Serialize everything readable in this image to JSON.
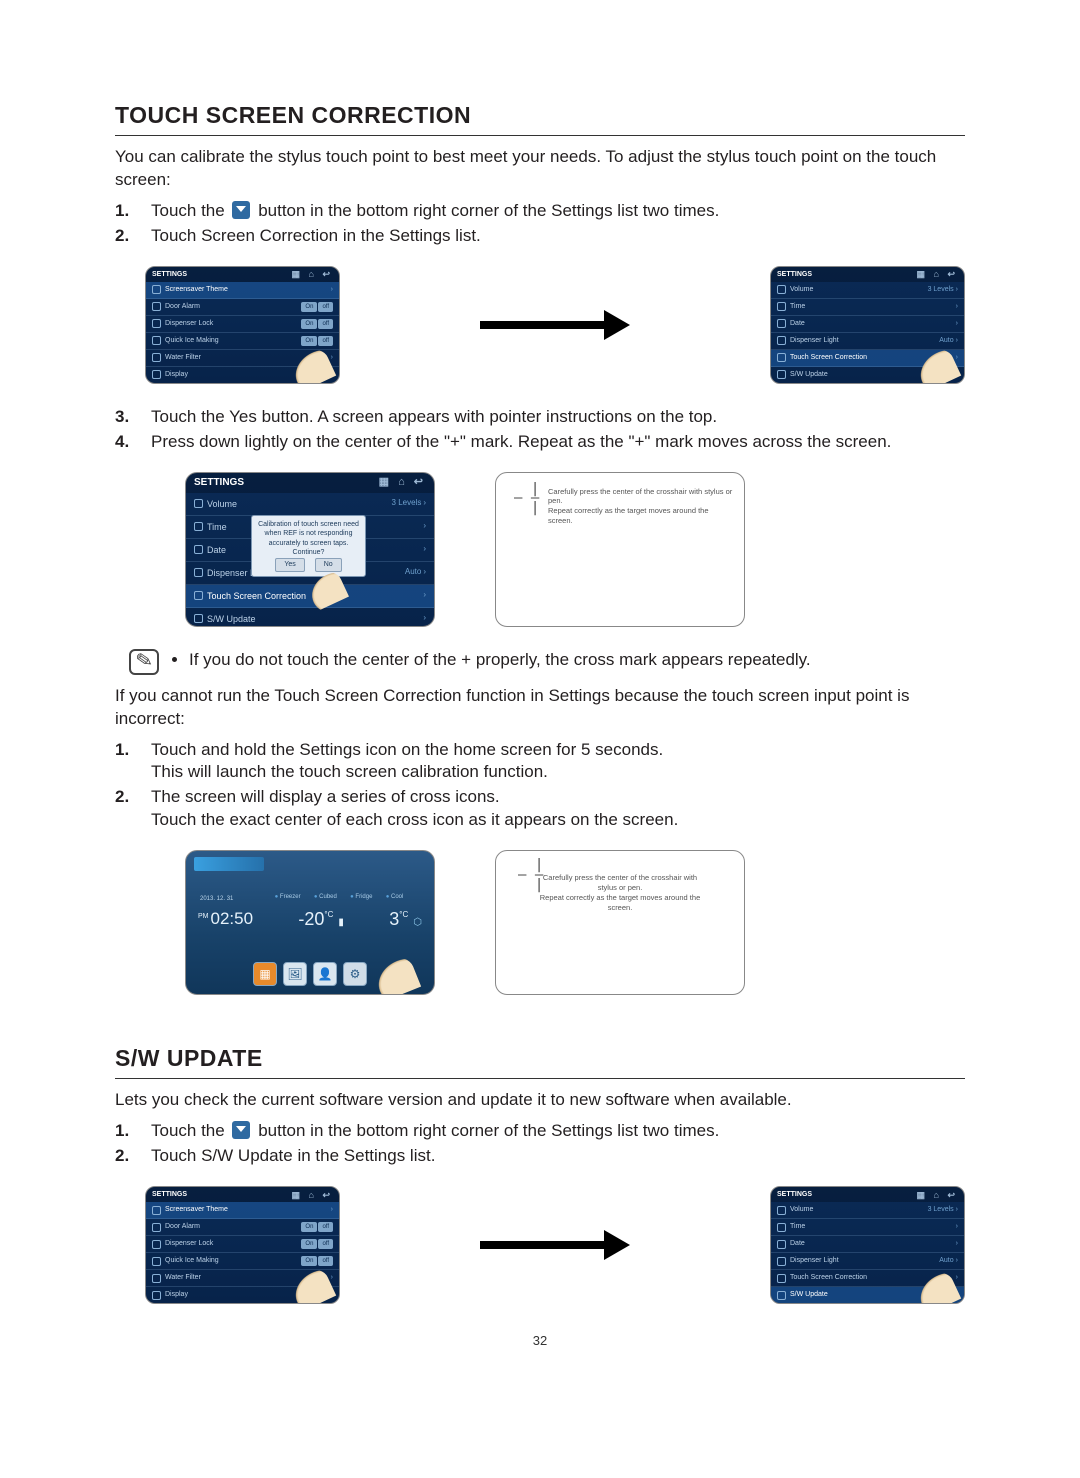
{
  "page_number": "32",
  "touch_correction": {
    "heading": "TOUCH SCREEN CORRECTION",
    "intro": "You can calibrate the stylus touch point to best meet your needs. To adjust the stylus touch point on the touch screen:",
    "steps_a": [
      {
        "n": "1.",
        "before": "Touch the ",
        "after": " button in the bottom right corner of the Settings list two times."
      },
      {
        "n": "2.",
        "text": "Touch Screen Correction in the Settings list."
      }
    ],
    "steps_b": [
      {
        "n": "3.",
        "text": "Touch the Yes button. A screen appears with pointer instructions on the top."
      },
      {
        "n": "4.",
        "text": "Press down lightly on the center of the \"+\" mark. Repeat as the \"+\" mark moves across the screen."
      }
    ],
    "note": "If you do not touch the center of the + properly, the cross mark appears repeatedly.",
    "alt_intro": "If you cannot run the Touch Screen Correction function in Settings because the touch screen input point is incorrect:",
    "alt_steps": [
      {
        "n": "1.",
        "l1": "Touch and hold the Settings icon on the home screen for 5 seconds.",
        "l2": "This will launch the touch screen calibration function."
      },
      {
        "n": "2.",
        "l1": "The screen will display a series of cross icons.",
        "l2": "Touch the exact center of each cross icon as it appears on the screen."
      }
    ]
  },
  "sw_update": {
    "heading": "S/W UPDATE",
    "intro": "Lets you check the current software version and update it to new software when available.",
    "steps": [
      {
        "n": "1.",
        "before": "Touch the ",
        "after": " button in the bottom right corner of the Settings list two times."
      },
      {
        "n": "2.",
        "text": "Touch S/W Update in the Settings list."
      }
    ]
  },
  "settings_panel_a": {
    "title": "SETTINGS",
    "rows": [
      {
        "label": "Screensaver Theme",
        "sel": true
      },
      {
        "label": "Door Alarm",
        "toggle": [
          "On",
          "off"
        ]
      },
      {
        "label": "Dispenser Lock",
        "toggle": [
          "On",
          "off"
        ]
      },
      {
        "label": "Quick Ice Making",
        "toggle": [
          "On",
          "off"
        ]
      },
      {
        "label": "Water Filter"
      },
      {
        "label": "Display"
      }
    ]
  },
  "settings_panel_b": {
    "title": "SETTINGS",
    "rows": [
      {
        "label": "Volume",
        "right": "3 Levels"
      },
      {
        "label": "Time"
      },
      {
        "label": "Date"
      },
      {
        "label": "Dispenser Light",
        "right": "Auto"
      },
      {
        "label": "Touch Screen Correction",
        "sel": true
      },
      {
        "label": "S/W Update"
      }
    ]
  },
  "settings_panel_b2": {
    "title": "SETTINGS",
    "rows": [
      {
        "label": "Volume",
        "right": "3 Levels"
      },
      {
        "label": "Time"
      },
      {
        "label": "Date"
      },
      {
        "label": "Dispenser Light",
        "right": "Auto"
      },
      {
        "label": "Touch Screen Correction"
      },
      {
        "label": "S/W Update",
        "sel": true
      }
    ]
  },
  "settings_panel_tall": {
    "title": "SETTINGS",
    "rows": [
      {
        "label": "Volume",
        "right": "3 Levels"
      },
      {
        "label": "Time"
      },
      {
        "label": "Date"
      },
      {
        "label": "Dispenser Li",
        "right": "Auto"
      },
      {
        "label": "Touch Screen Correction",
        "sel": true
      },
      {
        "label": "S/W Update"
      }
    ]
  },
  "popup": {
    "msg": "Calibration of touch screen need when REF is not responding accurately to screen taps. Continue?",
    "yes": "Yes",
    "no": "No"
  },
  "cal_instruction": {
    "l1": "Carefully press the center of the crosshair with stylus or pen.",
    "l2": "Repeat correctly as the target moves around the screen."
  },
  "home": {
    "date": "2013. 12. 31",
    "ampm": "PM",
    "time": "02:50",
    "labels": [
      "Freezer",
      "Cubed",
      "Fridge",
      "Cool"
    ],
    "t1": "-20",
    "u1": "°C",
    "t2": "3",
    "u2": "°C"
  }
}
